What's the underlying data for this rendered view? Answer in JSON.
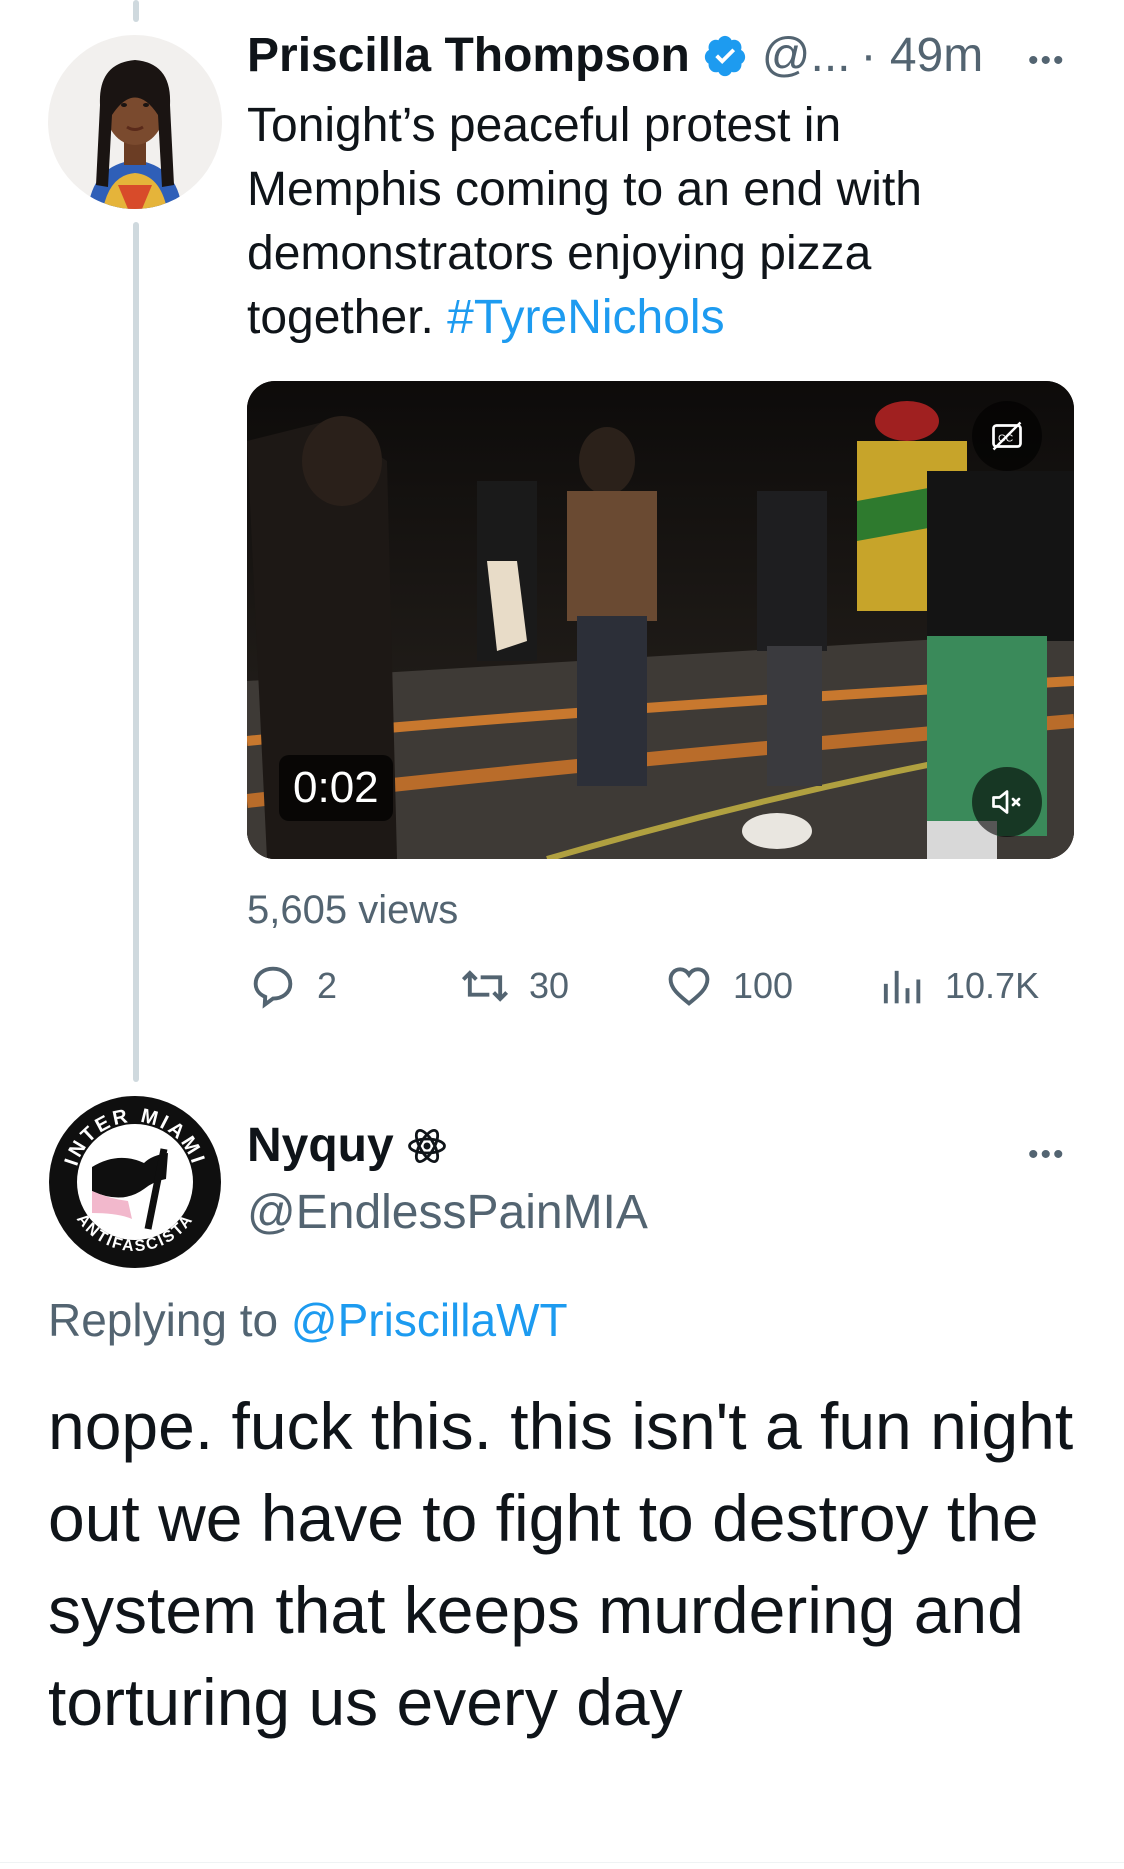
{
  "original_tweet": {
    "display_name": "Priscilla Thompson",
    "handle": "@...",
    "time": "· 49m",
    "more_label": "•••",
    "text": "Tonight’s peaceful protest in Memphis coming to an end with demonstrators enjoying pizza together. ",
    "hashtag": "#TyreNichols",
    "video": {
      "duration": "0:02",
      "cc_icon": "closed-captions-icon",
      "mute_icon": "volume-muted-icon"
    },
    "views": "5,605 views",
    "actions": {
      "replies": "2",
      "retweets": "30",
      "likes": "100",
      "analytics": "10.7K"
    }
  },
  "reply_tweet": {
    "display_name": "Nyquy",
    "badge_icon": "atom-badge-icon",
    "handle": "@EndlessPainMIA",
    "more_label": "•••",
    "replying_to_prefix": "Replying to ",
    "replying_to_handle": "@PriscillaWT",
    "text": "nope. fuck this. this isn't a fun night out we have to fight to destroy the system that keeps murdering and torturing us every day",
    "avatar": {
      "ring_text_top": "INTER MIAMI",
      "ring_text_bottom": "ANTIFASCISTA"
    }
  },
  "colors": {
    "accent": "#1d9bf0",
    "secondary_text": "#536471",
    "primary_text": "#0f1419",
    "thread_line": "#cfd9de"
  }
}
